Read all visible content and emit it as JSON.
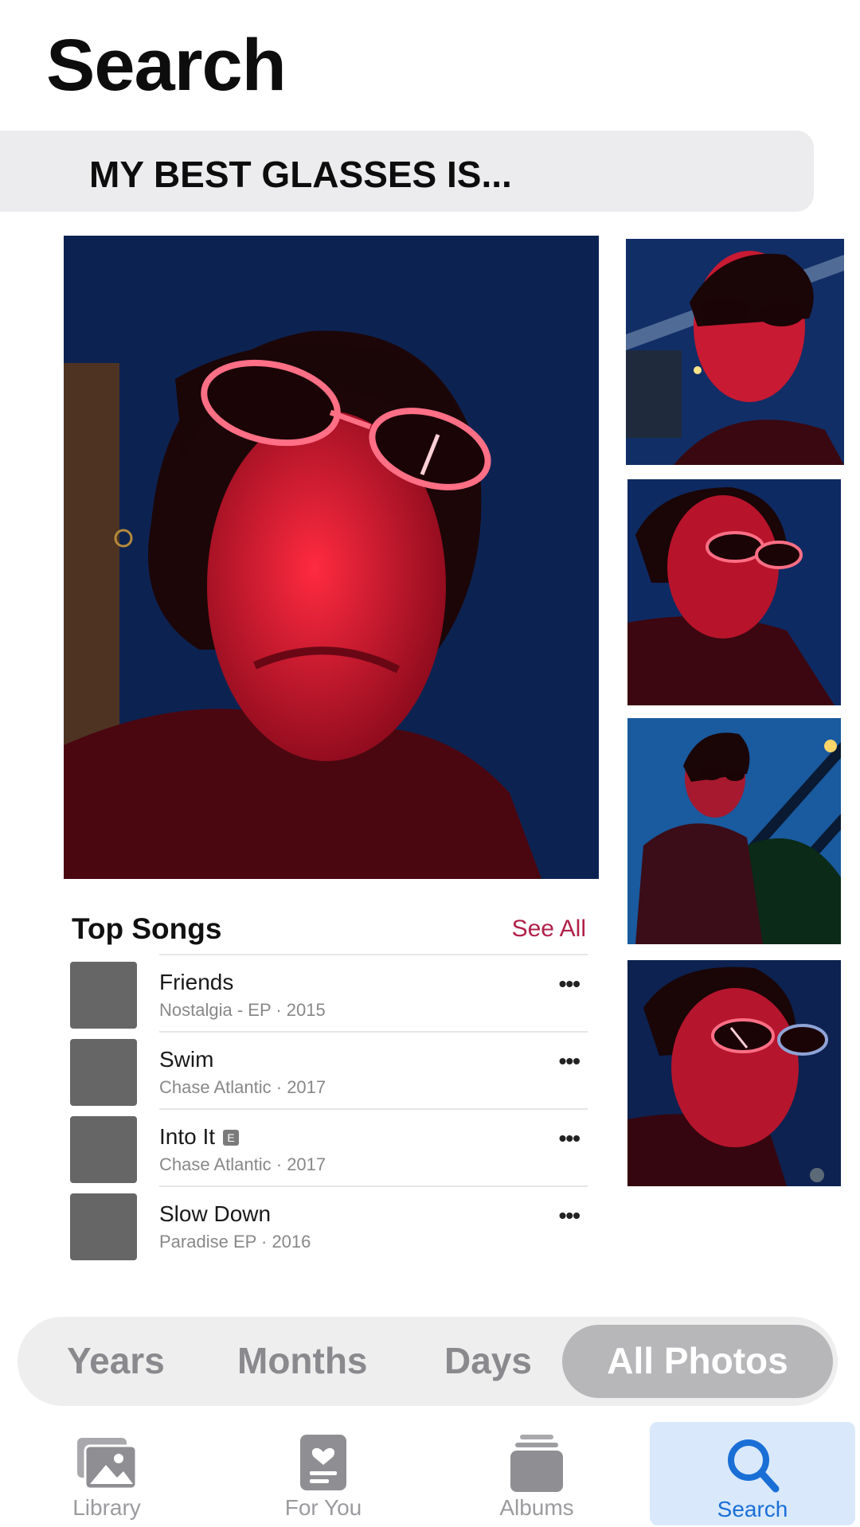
{
  "header": {
    "title": "Search"
  },
  "search": {
    "query": "MY BEST GLASSES IS..."
  },
  "top_songs": {
    "title": "Top Songs",
    "see_all": "See All",
    "items": [
      {
        "name": "Friends",
        "sub": "Nostalgia - EP · 2015",
        "explicit": false
      },
      {
        "name": "Swim",
        "sub": "Chase Atlantic · 2017",
        "explicit": false
      },
      {
        "name": "Into It",
        "sub": "Chase Atlantic · 2017",
        "explicit": true
      },
      {
        "name": "Slow Down",
        "sub": "Paradise EP · 2016",
        "explicit": false
      }
    ],
    "more_glyph": "•••",
    "explicit_glyph": "E"
  },
  "segment": {
    "years": "Years",
    "months": "Months",
    "days": "Days",
    "all_photos": "All Photos",
    "selected": "All Photos"
  },
  "tabs": {
    "library": {
      "label": "Library",
      "icon": "photo-library-icon"
    },
    "for_you": {
      "label": "For You",
      "icon": "for-you-icon"
    },
    "albums": {
      "label": "Albums",
      "icon": "albums-icon"
    },
    "search": {
      "label": "Search",
      "icon": "search-icon",
      "selected": true
    }
  },
  "colors": {
    "accent": "#1a6fd6",
    "see_all": "#b0224a",
    "photo_red": "#c4142e",
    "photo_blue": "#0d2a5e"
  }
}
